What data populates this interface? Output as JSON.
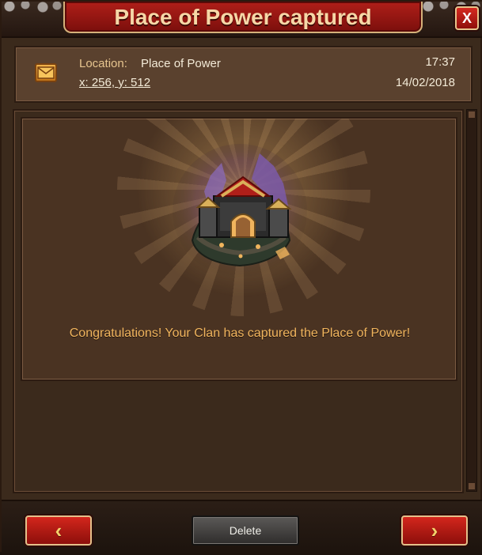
{
  "window": {
    "title": "Place of Power captured",
    "close_label": "X"
  },
  "header": {
    "location_label": "Location:",
    "location_value": "Place of Power",
    "coords": "x: 256, y: 512",
    "time": "17:37",
    "date": "14/02/2018",
    "icon": "mail-icon"
  },
  "message": {
    "text": "Congratulations! Your Clan has captured the Place of Power!",
    "image": "place-of-power-castle"
  },
  "footer": {
    "prev_label": "‹",
    "delete_label": "Delete",
    "next_label": "›"
  },
  "colors": {
    "title_red": "#b01f19",
    "accent_gold": "#f0b45d",
    "panel_brown": "#4a3322"
  }
}
